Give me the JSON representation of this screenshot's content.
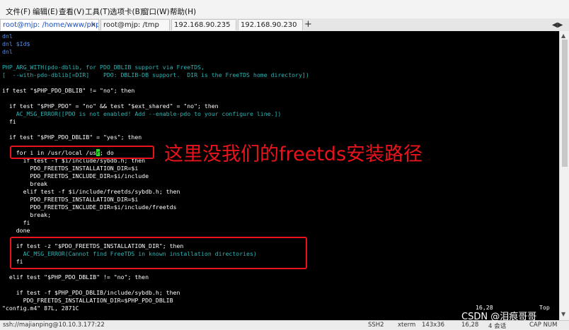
{
  "menu": [
    "文件(F)",
    "编辑(E)",
    "查看(V)",
    "工具(T)",
    "选项卡(B)",
    "窗口(W)",
    "帮助(H)"
  ],
  "tabs": [
    {
      "label": "root@mjp: /home/www/php/...",
      "active": true
    },
    {
      "label": "root@mjp: /tmp",
      "active": false
    },
    {
      "label": "192.168.90.235",
      "active": false
    },
    {
      "label": "192.168.90.230",
      "active": false
    }
  ],
  "tab_close": "×",
  "tab_add": "+",
  "tab_menu": "◀▶",
  "terminal": {
    "lines": [
      {
        "text": "dnl",
        "style": "comment"
      },
      {
        "text": "dnl $Id$",
        "style": "comment"
      },
      {
        "text": "dnl",
        "style": "comment"
      },
      {
        "text": "",
        "style": "normal"
      },
      {
        "text": "PHP_ARG_WITH(pdo-dblib, for PDO_DBLIB support via FreeTDS,",
        "style": "macro"
      },
      {
        "text": "[  --with-pdo-dblib[=DIR]    PDO: DBLIB-DB support.  DIR is the FreeTDS home directory])",
        "style": "macro"
      },
      {
        "text": "",
        "style": "normal"
      },
      {
        "text": "if test \"$PHP_PDO_DBLIB\" != \"no\"; then",
        "style": "normal"
      },
      {
        "text": "",
        "style": "normal"
      },
      {
        "text": "  if test \"$PHP_PDO\" = \"no\" && test \"$ext_shared\" = \"no\"; then",
        "style": "normal"
      },
      {
        "text": "    AC_MSG_ERROR([PDO is not enabled! Add --enable-pdo to your configure line.])",
        "style": "macro"
      },
      {
        "text": "  fi",
        "style": "normal"
      },
      {
        "text": "",
        "style": "normal"
      },
      {
        "text": "  if test \"$PHP_PDO_DBLIB\" = \"yes\"; then",
        "style": "normal"
      },
      {
        "text": "",
        "style": "normal"
      },
      {
        "text": "    for i in /usr/local /usr; do",
        "style": "normal"
      },
      {
        "text": "      if test -f $i/include/sybdb.h; then",
        "style": "normal"
      },
      {
        "text": "        PDO_FREETDS_INSTALLATION_DIR=$i",
        "style": "normal"
      },
      {
        "text": "        PDO_FREETDS_INCLUDE_DIR=$i/include",
        "style": "normal"
      },
      {
        "text": "        break",
        "style": "normal"
      },
      {
        "text": "      elif test -f $i/include/freetds/sybdb.h; then",
        "style": "normal"
      },
      {
        "text": "        PDO_FREETDS_INSTALLATION_DIR=$i",
        "style": "normal"
      },
      {
        "text": "        PDO_FREETDS_INCLUDE_DIR=$i/include/freetds",
        "style": "normal"
      },
      {
        "text": "        break;",
        "style": "normal"
      },
      {
        "text": "      fi",
        "style": "normal"
      },
      {
        "text": "    done",
        "style": "normal"
      },
      {
        "text": "",
        "style": "normal"
      },
      {
        "text": "    if test -z \"$PDO_FREETDS_INSTALLATION_DIR\"; then",
        "style": "normal"
      },
      {
        "text": "      AC_MSG_ERROR(Cannot find FreeTDS in known installation directories)",
        "style": "macro"
      },
      {
        "text": "    fi",
        "style": "normal"
      },
      {
        "text": "",
        "style": "normal"
      },
      {
        "text": "  elif test \"$PHP_PDO_DBLIB\" != \"no\"; then",
        "style": "normal"
      },
      {
        "text": "",
        "style": "normal"
      },
      {
        "text": "    if test -f $PHP_PDO_DBLIB/include/sybdb.h; then",
        "style": "normal"
      },
      {
        "text": "      PDO_FREETDS_INSTALLATION_DIR=$PHP_PDO_DBLIB",
        "style": "normal"
      },
      {
        "text": "\"config.m4\" 87L, 2871C",
        "style": "normal"
      }
    ],
    "ruler_position": "16,28",
    "ruler_scroll": "Top"
  },
  "annotation": {
    "text": "这里没我们的freetds安装路径",
    "color": "#e8131b"
  },
  "status": {
    "connection": "ssh://majianping@10.10.3.177:22",
    "protocol": "SSH2",
    "terminal_type": "xterm",
    "size": "143x36",
    "position": "16,28",
    "sessions": "4 会话",
    "caps": "CAP NUM"
  },
  "watermark": "CSDN @泪痕哥哥"
}
